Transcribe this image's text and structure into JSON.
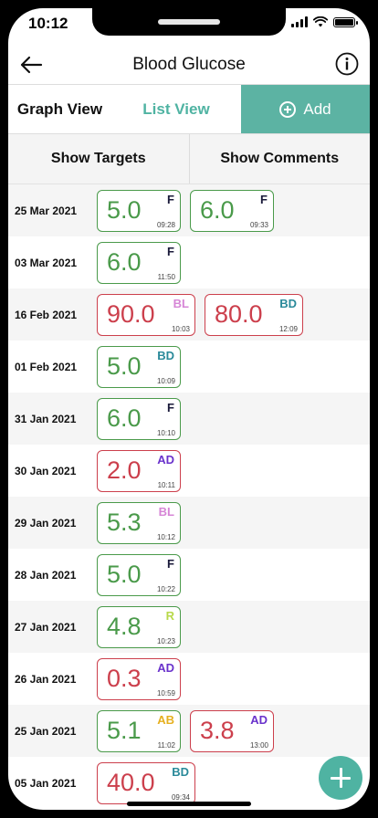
{
  "status": {
    "time": "10:12"
  },
  "header": {
    "title": "Blood Glucose"
  },
  "tabs": {
    "graph": "Graph View",
    "list": "List View",
    "add": "Add"
  },
  "toggles": {
    "targets": "Show Targets",
    "comments": "Show Comments"
  },
  "colors": {
    "accent": "#5cb3a3",
    "in_range": "#4a9a4a",
    "out_of_range": "#cc3f4c",
    "tag_F": "#1a1a3a",
    "tag_BL": "#d685d6",
    "tag_BD": "#2a8a9a",
    "tag_AD": "#6a33cc",
    "tag_AB": "#e6b020",
    "tag_R": "#b8d94a"
  },
  "entries": [
    {
      "date": "25 Mar 2021",
      "readings": [
        {
          "value": "5.0",
          "tag": "F",
          "time": "09:28",
          "status": "green"
        },
        {
          "value": "6.0",
          "tag": "F",
          "time": "09:33",
          "status": "green"
        }
      ]
    },
    {
      "date": "03 Mar 2021",
      "readings": [
        {
          "value": "6.0",
          "tag": "F",
          "time": "11:50",
          "status": "green"
        }
      ]
    },
    {
      "date": "16 Feb 2021",
      "readings": [
        {
          "value": "90.0",
          "tag": "BL",
          "time": "10:03",
          "status": "red"
        },
        {
          "value": "80.0",
          "tag": "BD",
          "time": "12:09",
          "status": "red"
        }
      ]
    },
    {
      "date": "01 Feb 2021",
      "readings": [
        {
          "value": "5.0",
          "tag": "BD",
          "time": "10:09",
          "status": "green"
        }
      ]
    },
    {
      "date": "31 Jan 2021",
      "readings": [
        {
          "value": "6.0",
          "tag": "F",
          "time": "10:10",
          "status": "green"
        }
      ]
    },
    {
      "date": "30 Jan 2021",
      "readings": [
        {
          "value": "2.0",
          "tag": "AD",
          "time": "10:11",
          "status": "red"
        }
      ]
    },
    {
      "date": "29 Jan 2021",
      "readings": [
        {
          "value": "5.3",
          "tag": "BL",
          "time": "10:12",
          "status": "green"
        }
      ]
    },
    {
      "date": "28 Jan 2021",
      "readings": [
        {
          "value": "5.0",
          "tag": "F",
          "time": "10:22",
          "status": "green"
        }
      ]
    },
    {
      "date": "27 Jan 2021",
      "readings": [
        {
          "value": "4.8",
          "tag": "R",
          "time": "10:23",
          "status": "green"
        }
      ]
    },
    {
      "date": "26 Jan 2021",
      "readings": [
        {
          "value": "0.3",
          "tag": "AD",
          "time": "10:59",
          "status": "red"
        }
      ]
    },
    {
      "date": "25 Jan 2021",
      "readings": [
        {
          "value": "5.1",
          "tag": "AB",
          "time": "11:02",
          "status": "green"
        },
        {
          "value": "3.8",
          "tag": "AD",
          "time": "13:00",
          "status": "red"
        }
      ]
    },
    {
      "date": "05 Jan 2021",
      "readings": [
        {
          "value": "40.0",
          "tag": "BD",
          "time": "09:34",
          "status": "red"
        }
      ]
    }
  ]
}
